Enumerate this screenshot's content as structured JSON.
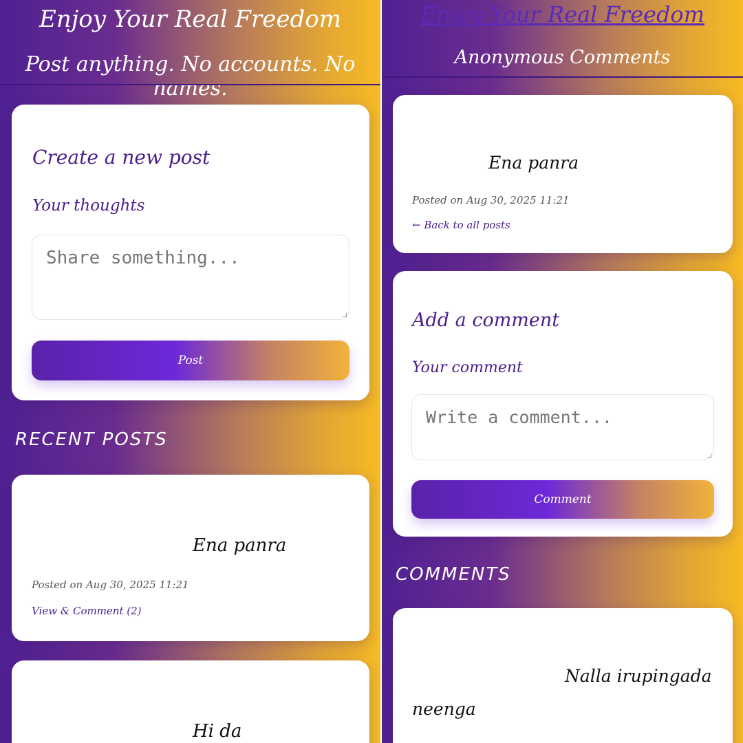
{
  "left": {
    "header": {
      "title": "Enjoy Your Real Freedom",
      "subtitle": "Post anything. No accounts. No names."
    },
    "create": {
      "title": "Create a new post",
      "label": "Your thoughts",
      "placeholder": "Share something...",
      "button": "Post"
    },
    "recent_title": "RECENT POSTS",
    "posts": [
      {
        "text": "Ena panra",
        "meta": "Posted on Aug 30, 2025 11:21",
        "link": "View & Comment (2)"
      },
      {
        "text": "Hi da"
      }
    ]
  },
  "right": {
    "header": {
      "title": "Enjoy Your Real Freedom",
      "subtitle": "Anonymous Comments"
    },
    "post": {
      "text": "Ena panra",
      "meta": "Posted on Aug 30, 2025 11:21",
      "back": "← Back to all posts"
    },
    "comment_form": {
      "title": "Add a comment",
      "label": "Your comment",
      "placeholder": "Write a comment...",
      "button": "Comment"
    },
    "comments_title": "COMMENTS",
    "comments": [
      {
        "text_line1": "Nalla irupingada",
        "text_line2": "neenga"
      }
    ]
  },
  "colors": {
    "accent": "#4a1d8c",
    "gradient_start": "#4f2192",
    "gradient_end": "#f6bb25"
  }
}
